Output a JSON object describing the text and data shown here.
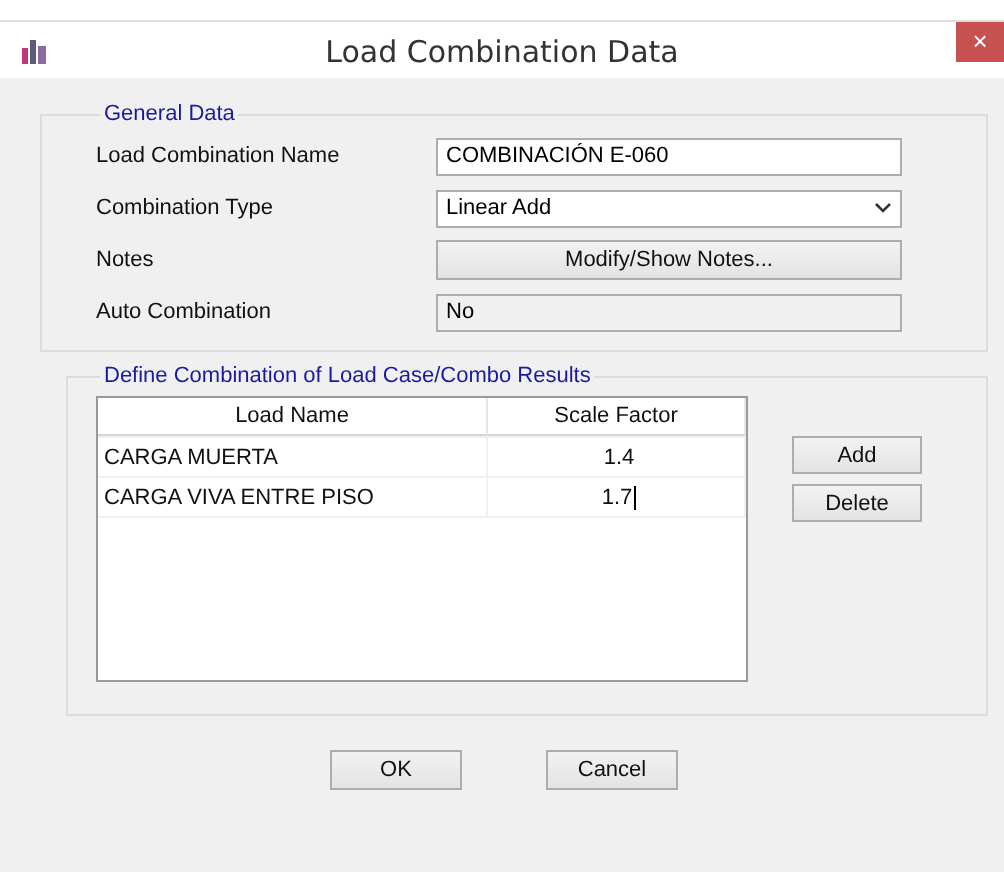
{
  "window": {
    "title": "Load Combination Data",
    "close": "×"
  },
  "general_data": {
    "title": "General Data",
    "fields": [
      {
        "kind": "text",
        "label": "Load Combination Name",
        "value": "COMBINACIÓN E-060"
      },
      {
        "kind": "select",
        "label": "Combination Type",
        "value": "Linear Add"
      },
      {
        "kind": "button",
        "label": "Notes",
        "value": "Modify/Show Notes..."
      },
      {
        "kind": "readonly",
        "label": "Auto Combination",
        "value": "No"
      }
    ]
  },
  "combination": {
    "title": "Define Combination of Load Case/Combo Results",
    "table": {
      "columns": [
        "Load Name",
        "Scale Factor"
      ],
      "rows": [
        {
          "cells": [
            "CARGA MUERTA",
            "1.4"
          ],
          "editing": false
        },
        {
          "cells": [
            "CARGA VIVA ENTRE PISO",
            "1.7"
          ],
          "editing": true
        }
      ]
    },
    "buttons": [
      "Add",
      "Delete"
    ]
  },
  "buttons": [
    "OK",
    "Cancel"
  ]
}
